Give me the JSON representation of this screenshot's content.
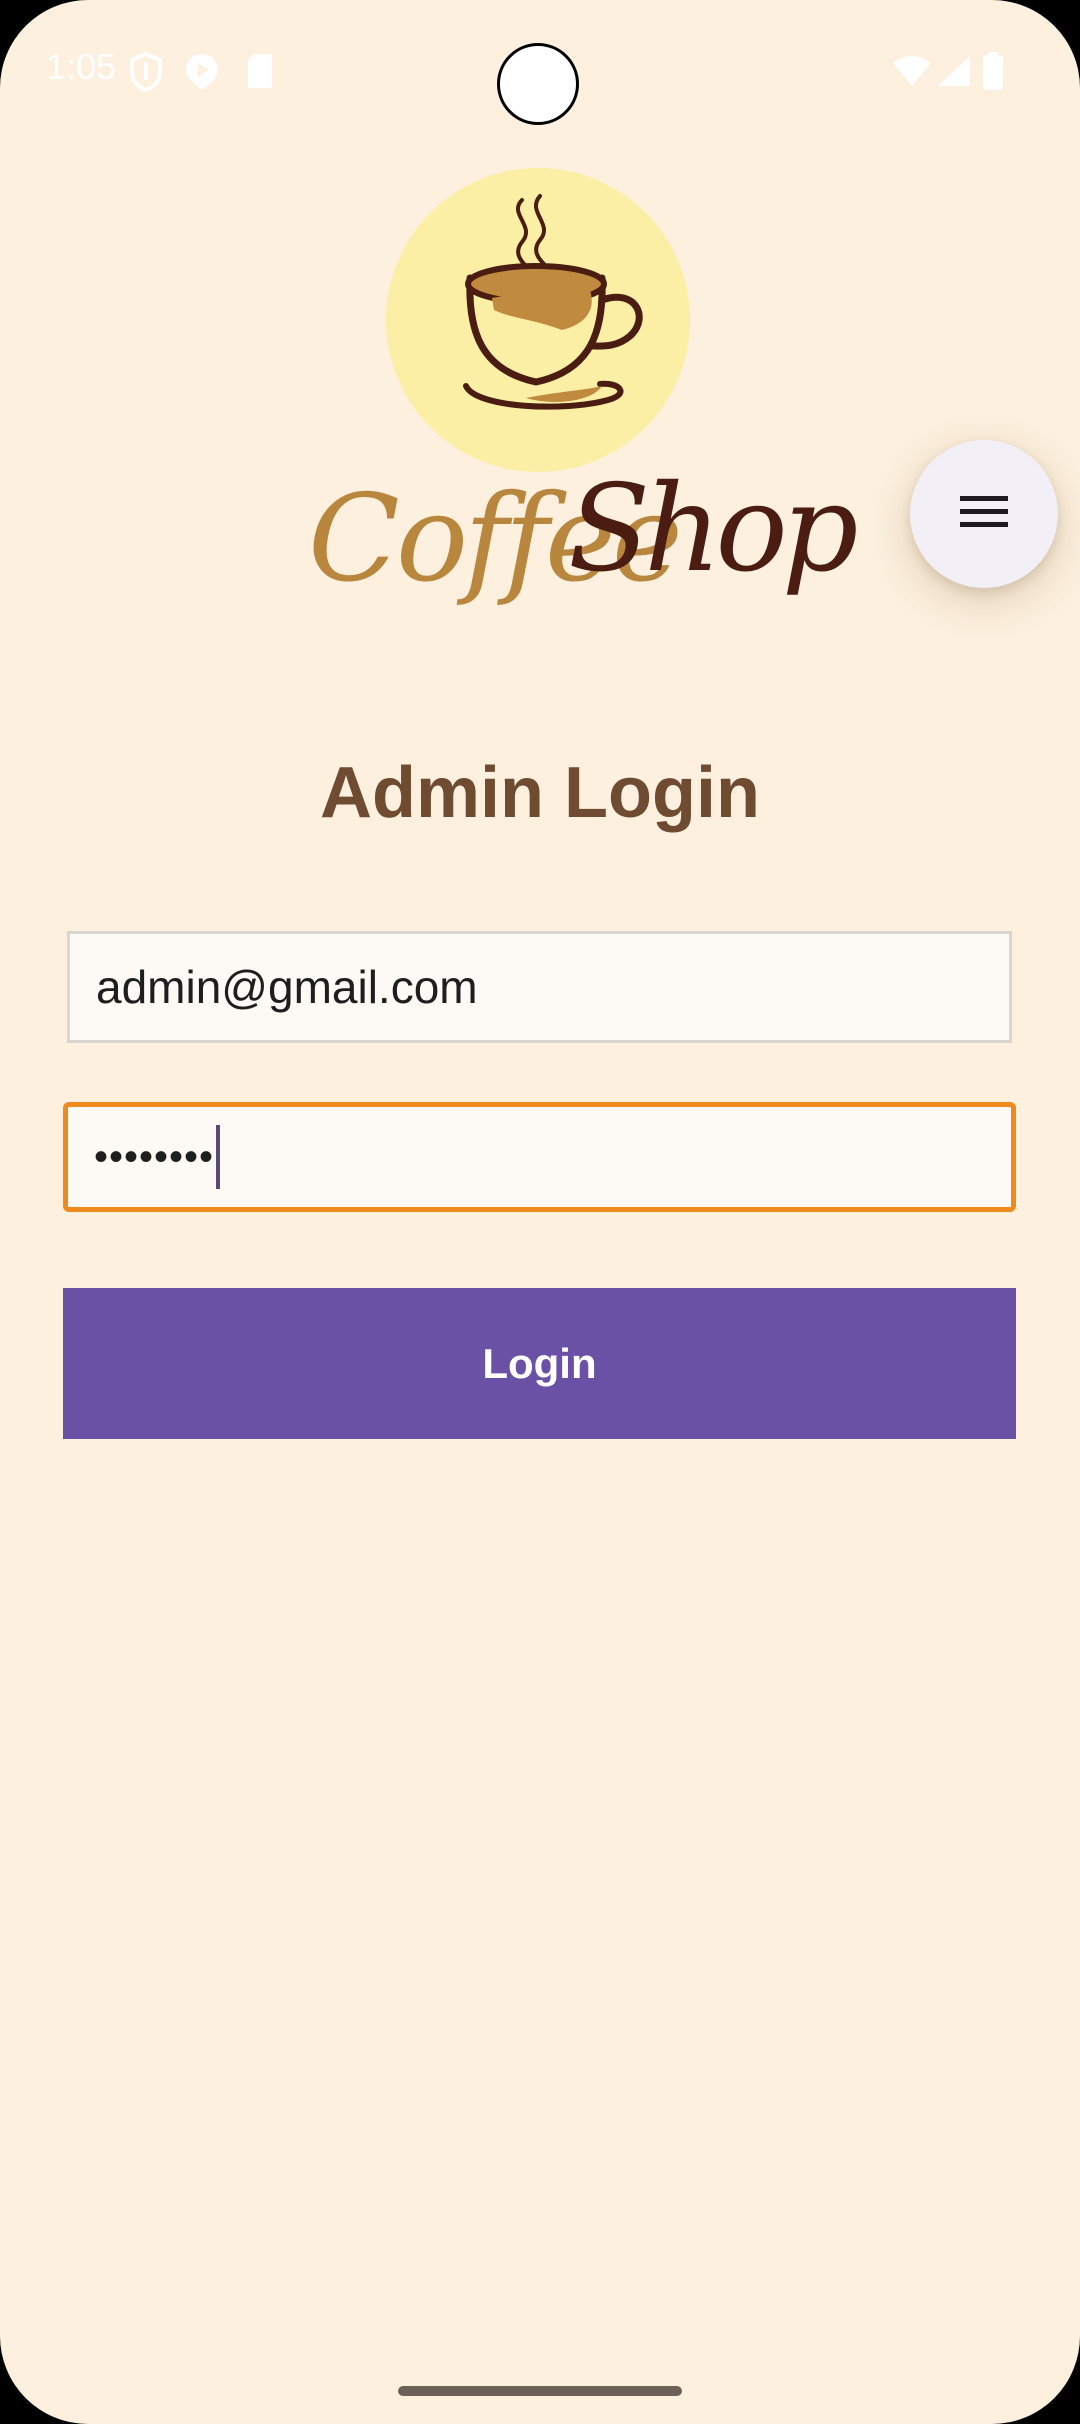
{
  "status_bar": {
    "time": "1:05"
  },
  "logo": {
    "brand_name": "CoffeeShop",
    "word_coffee": "Coffee",
    "word_shop": "Shop"
  },
  "menu": {
    "icon": "menu-icon"
  },
  "page": {
    "title": "Admin Login"
  },
  "form": {
    "email_value": "admin@gmail.com",
    "password_value": "••••••••",
    "login_label": "Login"
  },
  "colors": {
    "background": "#fdf0de",
    "title": "#6f4b31",
    "button": "#6a51a5",
    "focus_border": "#f08a1e"
  }
}
